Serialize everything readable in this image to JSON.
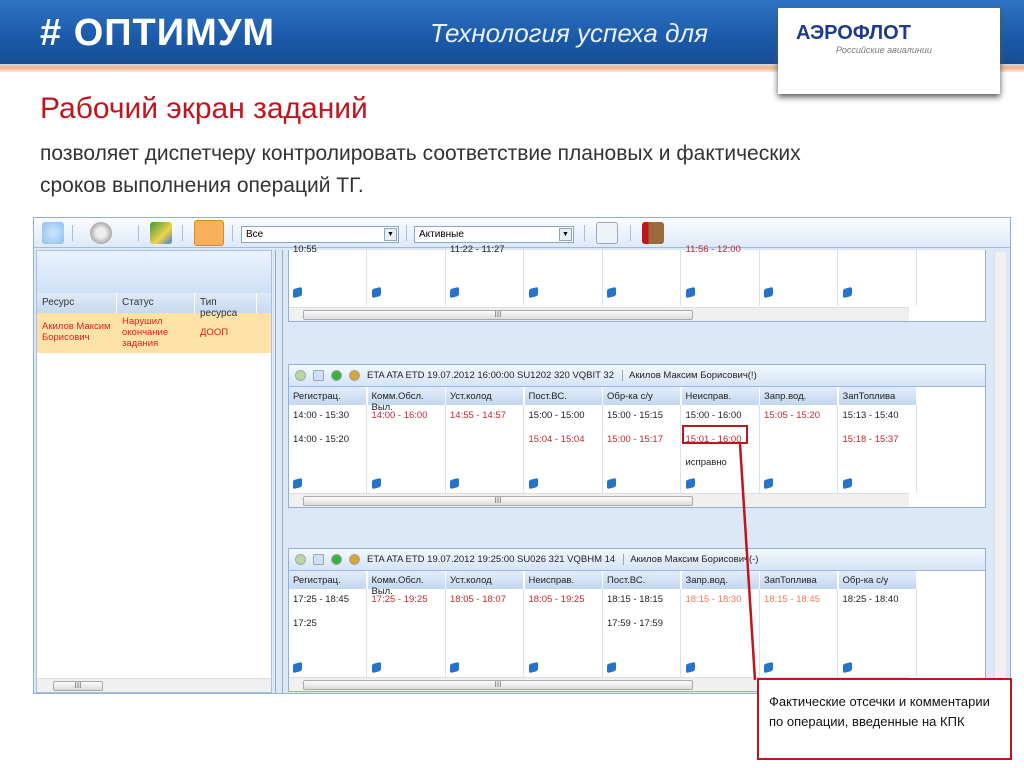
{
  "banner": {
    "logo": "# ОПТИМУМ",
    "tagline": "Технология успеха для",
    "partner": "АЭРОФЛОТ",
    "partner_sub": "Российские авиалинии"
  },
  "slide": {
    "title": "Рабочий экран заданий",
    "subtitle": "позволяет диспетчеру контролировать соответствие плановых и фактических сроков выполнения операций ТГ."
  },
  "toolbar": {
    "filter1": "Все",
    "filter2": "Активные"
  },
  "left_panel": {
    "columns": [
      "Ресурс",
      "Статус",
      "Тип ресурса"
    ],
    "rows": [
      {
        "resource": "Акилов Максим Борисович",
        "status": "Нарушил окончание задания",
        "type": "ДООП"
      }
    ]
  },
  "colors": {
    "normal": "#222222",
    "late": "#c0282d",
    "warn": "#f07850"
  },
  "top_card": {
    "partial": [
      {
        "text": "10:55",
        "color": "#222222"
      },
      {
        "text": "",
        "color": "#222222"
      },
      {
        "text": "11:22 - 11:27",
        "color": "#222222"
      },
      {
        "text": "",
        "color": "#222222"
      },
      {
        "text": "",
        "color": "#222222"
      },
      {
        "text": "11:56 - 12:00",
        "color": "#c0282d"
      },
      {
        "text": "",
        "color": "#222222"
      },
      {
        "text": "",
        "color": "#222222"
      }
    ]
  },
  "cards": [
    {
      "header": "ETA ATA ETD 19.07.2012 16:00:00 SU1202 320 VQBIT 32",
      "person": "Акилов Максим Борисович(!)",
      "columns": [
        {
          "name": "Регистрац.",
          "plan": {
            "text": "14:00 - 15:30",
            "color": "#222222"
          },
          "fact": {
            "text": "14:00 - 15:20",
            "color": "#222222"
          },
          "comment": ""
        },
        {
          "name": "Комм.Обсл. Выл.",
          "plan": {
            "text": "14:00 - 16:00",
            "color": "#c0282d"
          },
          "fact": {
            "text": "",
            "color": "#222222"
          },
          "comment": ""
        },
        {
          "name": "Уст.колод",
          "plan": {
            "text": "14:55 - 14:57",
            "color": "#c0282d"
          },
          "fact": {
            "text": "",
            "color": "#222222"
          },
          "comment": ""
        },
        {
          "name": "Пост.ВС.",
          "plan": {
            "text": "15:00 - 15:00",
            "color": "#222222"
          },
          "fact": {
            "text": "15:04 - 15:04",
            "color": "#c0282d"
          },
          "comment": ""
        },
        {
          "name": "Обр-ка с/у",
          "plan": {
            "text": "15:00 - 15:15",
            "color": "#222222"
          },
          "fact": {
            "text": "15:00 - 15:17",
            "color": "#c0282d"
          },
          "comment": ""
        },
        {
          "name": "Неисправ.",
          "plan": {
            "text": "15:00 - 16:00",
            "color": "#222222"
          },
          "fact": {
            "text": "15:01 - 16:00",
            "color": "#c0282d"
          },
          "comment": "исправно"
        },
        {
          "name": "Запр.вод.",
          "plan": {
            "text": "15:05 - 15:20",
            "color": "#c0282d"
          },
          "fact": {
            "text": "",
            "color": "#222222"
          },
          "comment": ""
        },
        {
          "name": "ЗапТоплива",
          "plan": {
            "text": "15:13 - 15:40",
            "color": "#222222"
          },
          "fact": {
            "text": "15:18 - 15:37",
            "color": "#c0282d"
          },
          "comment": ""
        }
      ]
    },
    {
      "header": "ETA ATA ETD 19.07.2012 19:25:00 SU026 321 VQBHM 14",
      "person": "Акилов Максим Борисович(-)",
      "columns": [
        {
          "name": "Регистрац.",
          "plan": {
            "text": "17:25 - 18:45",
            "color": "#222222"
          },
          "fact": {
            "text": "17:25",
            "color": "#222222"
          },
          "comment": ""
        },
        {
          "name": "Комм.Обсл. Выл.",
          "plan": {
            "text": "17:25 - 19:25",
            "color": "#c0282d"
          },
          "fact": {
            "text": "",
            "color": "#222222"
          },
          "comment": ""
        },
        {
          "name": "Уст.колод",
          "plan": {
            "text": "18:05 - 18:07",
            "color": "#c0282d"
          },
          "fact": {
            "text": "",
            "color": "#222222"
          },
          "comment": ""
        },
        {
          "name": "Неисправ.",
          "plan": {
            "text": "18:05 - 19:25",
            "color": "#c0282d"
          },
          "fact": {
            "text": "",
            "color": "#222222"
          },
          "comment": ""
        },
        {
          "name": "Пост.ВС.",
          "plan": {
            "text": "18:15 - 18:15",
            "color": "#222222"
          },
          "fact": {
            "text": "17:59 - 17:59",
            "color": "#222222"
          },
          "comment": ""
        },
        {
          "name": "Запр.вод.",
          "plan": {
            "text": "18:15 - 18:30",
            "color": "#f07850"
          },
          "fact": {
            "text": "",
            "color": "#222222"
          },
          "comment": ""
        },
        {
          "name": "ЗапТоплива",
          "plan": {
            "text": "18:15 - 18:45",
            "color": "#f07850"
          },
          "fact": {
            "text": "",
            "color": "#222222"
          },
          "comment": ""
        },
        {
          "name": "Обр-ка с/у",
          "plan": {
            "text": "18:25 - 18:40",
            "color": "#222222"
          },
          "fact": {
            "text": "",
            "color": "#222222"
          },
          "comment": ""
        }
      ]
    }
  ],
  "annotation": "Фактические отсечки и комментарии по операции, введенные на КПК"
}
